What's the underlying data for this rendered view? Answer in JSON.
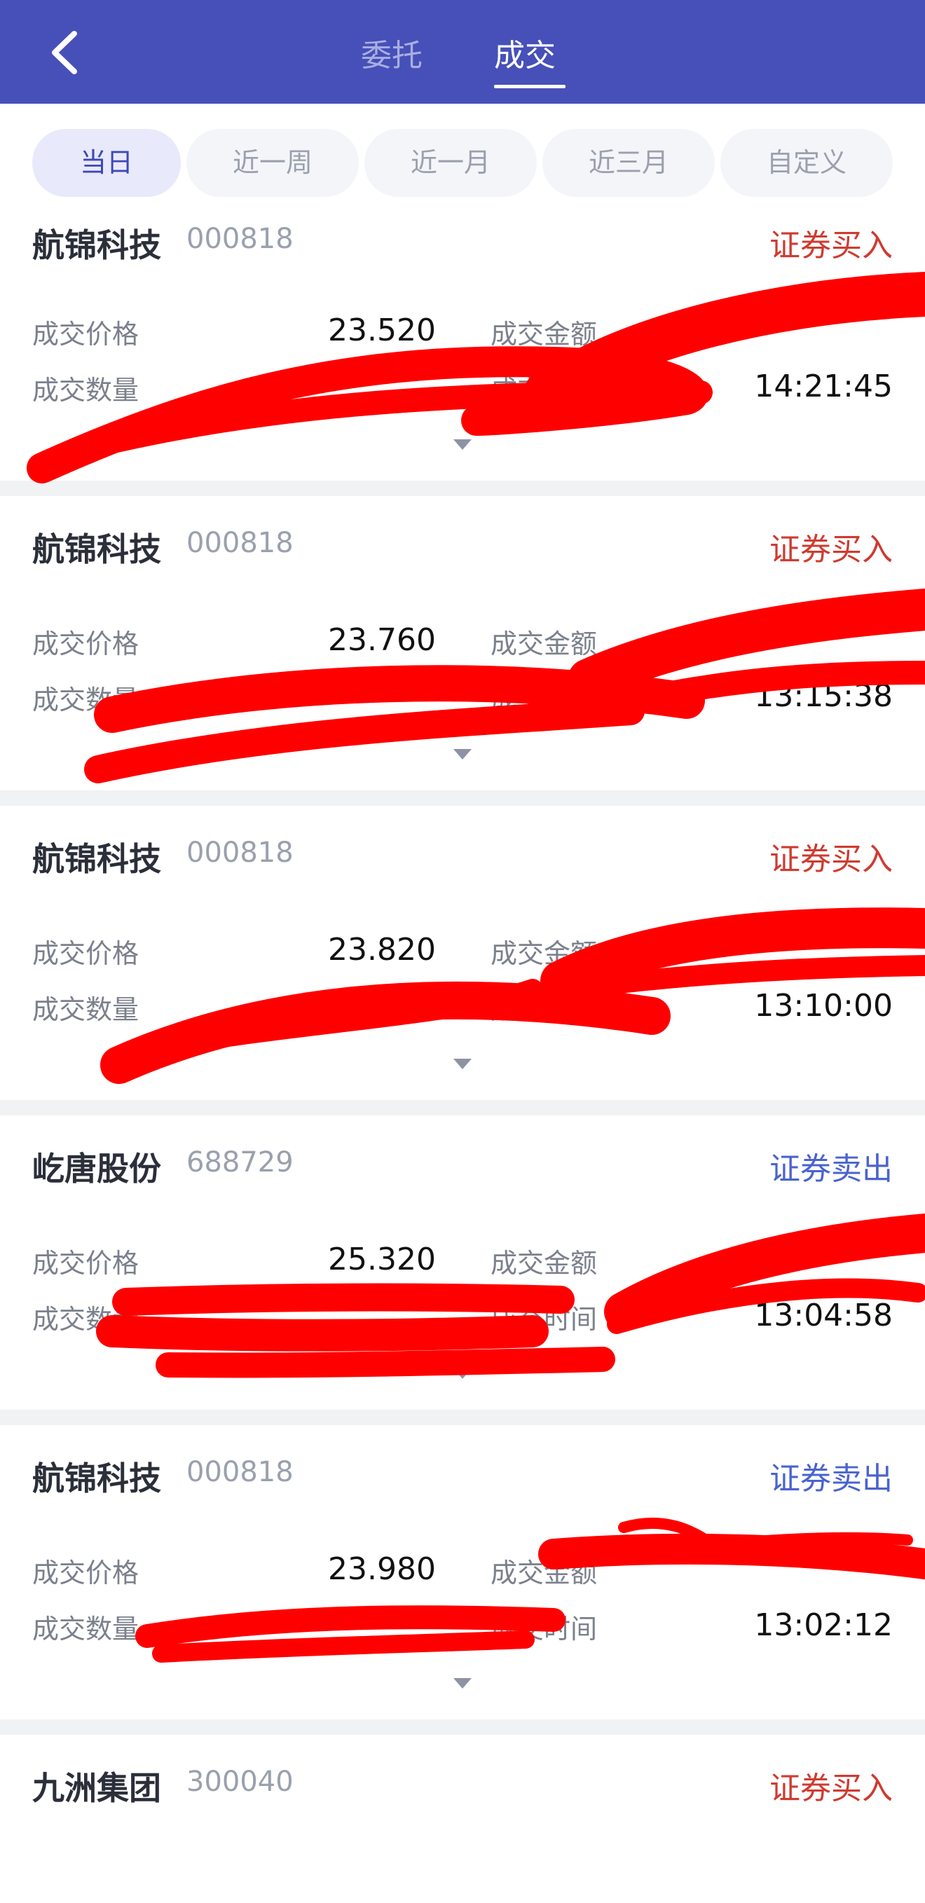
{
  "header": {
    "tabs": [
      {
        "label": "委托",
        "active": false
      },
      {
        "label": "成交",
        "active": true
      }
    ]
  },
  "filters": [
    {
      "label": "当日",
      "selected": true
    },
    {
      "label": "近一周",
      "selected": false
    },
    {
      "label": "近一月",
      "selected": false
    },
    {
      "label": "近三月",
      "selected": false
    },
    {
      "label": "自定义",
      "selected": false
    }
  ],
  "labels": {
    "price": "成交价格",
    "amount": "成交金额",
    "quantity": "成交数量",
    "time": "成交时间"
  },
  "trades": [
    {
      "name": "航锦科技",
      "code": "000818",
      "type": "证券买入",
      "side": "buy",
      "price": "23.520",
      "time": "14:21:45"
    },
    {
      "name": "航锦科技",
      "code": "000818",
      "type": "证券买入",
      "side": "buy",
      "price": "23.760",
      "time": "13:15:38"
    },
    {
      "name": "航锦科技",
      "code": "000818",
      "type": "证券买入",
      "side": "buy",
      "price": "23.820",
      "time": "13:10:00"
    },
    {
      "name": "屹唐股份",
      "code": "688729",
      "type": "证券卖出",
      "side": "sell",
      "price": "25.320",
      "time": "13:04:58"
    },
    {
      "name": "航锦科技",
      "code": "000818",
      "type": "证券卖出",
      "side": "sell",
      "price": "23.980",
      "time": "13:02:12"
    },
    {
      "name": "九洲集团",
      "code": "300040",
      "type": "证券买入",
      "side": "buy"
    }
  ],
  "colors": {
    "header_bg": "#4650b8",
    "buy": "#cf3b30",
    "sell": "#4a63d0",
    "redaction": "#ff0000"
  }
}
